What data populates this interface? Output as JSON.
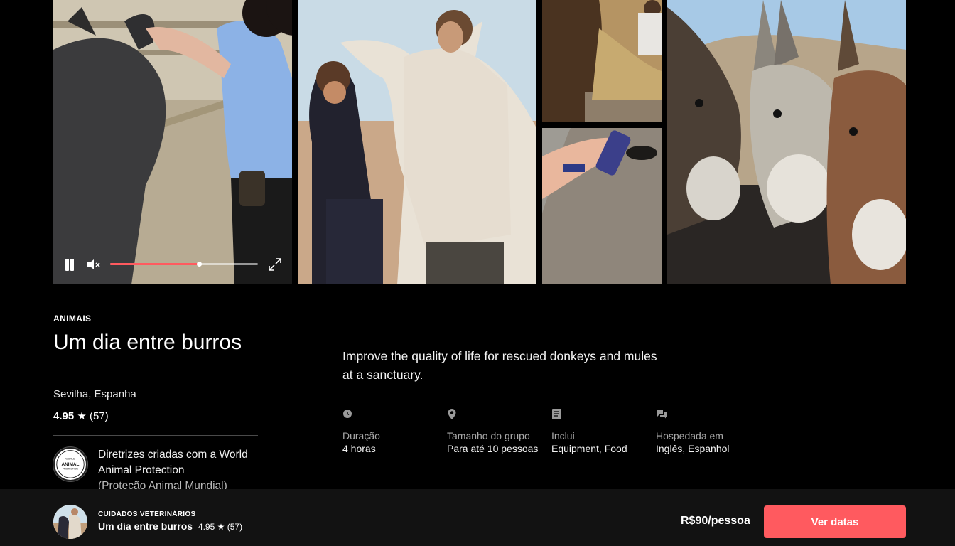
{
  "gallery": {
    "video": {
      "progress": 0.6,
      "controls": [
        "pause-icon",
        "mute-icon",
        "fullscreen-icon"
      ]
    }
  },
  "experience": {
    "category": "ANIMAIS",
    "title": "Um dia entre burros",
    "location": "Sevilha, Espanha",
    "rating": "4.95",
    "star": "★",
    "reviews": "(57)",
    "partner_text": "Diretrizes criadas com a World Animal Protection",
    "partner_sub": "(Proteção Animal Mundial)",
    "partner_logo_lettering": "WORLD ANIMAL PROTECTION",
    "description": "Improve the quality of life for rescued donkeys and mules at a sanctuary."
  },
  "facts": [
    {
      "icon": "clock-icon",
      "label": "Duração",
      "value": "4 horas"
    },
    {
      "icon": "location-pin-icon",
      "label": "Tamanho do grupo",
      "value": "Para até 10 pessoas"
    },
    {
      "icon": "list-icon",
      "label": "Inclui",
      "value": "Equipment, Food"
    },
    {
      "icon": "chat-icon",
      "label": "Hospedada em",
      "value": "Inglês, Espanhol"
    }
  ],
  "bottom_bar": {
    "category": "CUIDADOS VETERINÁRIOS",
    "title": "Um dia entre burros",
    "rating": "4.95",
    "star": "★",
    "reviews": "(57)",
    "price": "R$90/pessoa",
    "cta": "Ver datas"
  },
  "colors": {
    "accent": "#ff5a5f",
    "background": "#000000",
    "bar_background": "#121212"
  }
}
